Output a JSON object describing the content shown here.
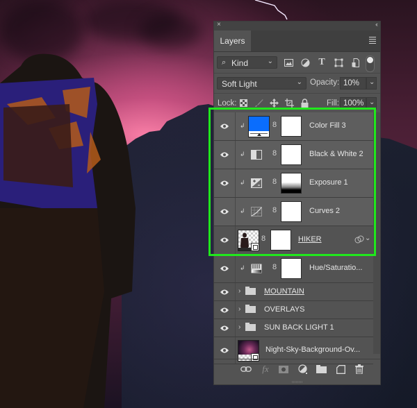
{
  "panel": {
    "close_glyph": "×",
    "collapse_glyph": "‹‹",
    "tab_label": "Layers",
    "menu_icon": "panel-menu-icon",
    "filter": {
      "search_icon": "⌕",
      "kind_label": "Kind",
      "chevron": "⌄",
      "icons": [
        "pixel-layer-filter-icon",
        "adjustment-layer-filter-icon",
        "type-layer-filter-icon",
        "shape-layer-filter-icon",
        "smart-object-filter-icon"
      ],
      "type_glyph": "T",
      "filter_toggle_on": true
    },
    "blend": {
      "mode": "Soft Light",
      "opacity_label": "Opacity:",
      "opacity_value": "10%"
    },
    "lock": {
      "label": "Lock:",
      "icons": [
        "lock-transparent-pixels-icon",
        "lock-image-pixels-icon",
        "lock-position-icon",
        "lock-artboard-icon",
        "lock-all-icon"
      ],
      "fill_label": "Fill:",
      "fill_value": "100%"
    },
    "layers": [
      {
        "name": "Color Fill 3",
        "type": "color-fill",
        "visible": true,
        "clipped": true,
        "fill_color": "#0a6dfd",
        "selected_group": true
      },
      {
        "name": "Black & White 2",
        "type": "black-white",
        "visible": true,
        "clipped": true,
        "selected_group": true
      },
      {
        "name": "Exposure 1",
        "type": "exposure",
        "visible": true,
        "clipped": true,
        "selected_group": true
      },
      {
        "name": "Curves 2",
        "type": "curves",
        "visible": true,
        "clipped": true,
        "selected_group": true
      },
      {
        "name": "HIKER",
        "type": "smart-object",
        "visible": true,
        "clipped": false,
        "underlined": true,
        "selected_group": true
      },
      {
        "name": "Hue/Saturatio...",
        "type": "hue-saturation",
        "visible": true,
        "clipped": true
      },
      {
        "name": "MOUNTAIN",
        "type": "group",
        "visible": true,
        "underlined": true
      },
      {
        "name": "OVERLAYS",
        "type": "group",
        "visible": true
      },
      {
        "name": "SUN BACK LIGHT 1",
        "type": "group",
        "visible": true
      },
      {
        "name": "Night-Sky-Background-Ov...",
        "type": "smart-object",
        "visible": true
      }
    ],
    "footer": {
      "link_glyph": "⛓",
      "fx_label": "fx",
      "icons": [
        "link-layers-icon",
        "layer-style-fx-icon",
        "add-mask-icon",
        "new-adjustment-layer-icon",
        "new-group-icon",
        "new-layer-icon",
        "delete-layer-icon"
      ]
    }
  },
  "highlight": {
    "color": "#20e81c",
    "label": "selected-layers-highlight"
  },
  "canvas": {
    "subject": "hiker with backpack facing pink night sky over rocky mountain"
  }
}
